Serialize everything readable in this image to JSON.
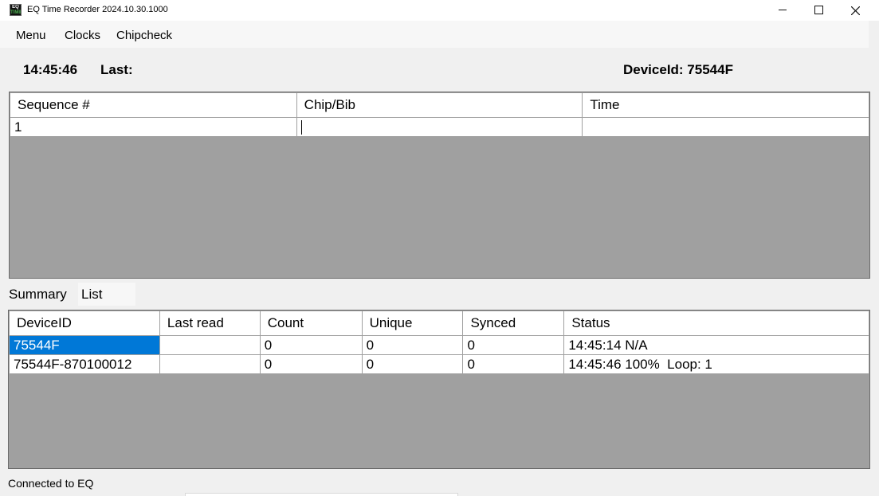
{
  "window": {
    "title": "EQ Time Recorder 2024.10.30.1000",
    "logo_text_top": "EQ",
    "logo_text_bottom": "TIMING",
    "minimize_icon": "minimize-icon",
    "maximize_icon": "maximize-icon",
    "close_icon": "close-icon"
  },
  "menu": {
    "items": [
      "Menu",
      "Clocks",
      "Chipcheck"
    ]
  },
  "header": {
    "clock": "14:45:46",
    "last_label": "Last:",
    "device_label": "DeviceId: 75544F"
  },
  "reads_table": {
    "columns": [
      "Sequence #",
      "Chip/Bib",
      "Time"
    ],
    "rows": [
      [
        "1",
        "",
        ""
      ]
    ]
  },
  "tabs": [
    "Summary",
    "List"
  ],
  "summary_table": {
    "columns": [
      "DeviceID",
      "Last read",
      "Count",
      "Unique",
      "Synced",
      "Status"
    ],
    "rows": [
      [
        "75544F",
        "",
        "0",
        "0",
        "0",
        "14:45:14 N/A"
      ],
      [
        "75544F-870100012",
        "",
        "0",
        "0",
        "0",
        "14:45:46 100%  Loop: 1"
      ]
    ]
  },
  "status": {
    "text": "Connected to EQ"
  },
  "colors": {
    "selection": "#0078d7",
    "grid_background": "#a0a0a0",
    "logo_accent": "#4caf50"
  }
}
